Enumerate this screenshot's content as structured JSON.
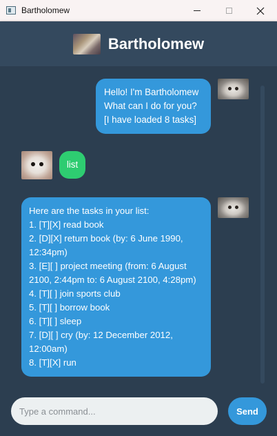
{
  "window": {
    "title": "Bartholomew"
  },
  "header": {
    "title": "Bartholomew"
  },
  "messages": [
    {
      "sender": "bot",
      "text": "Hello! I'm Bartholomew\nWhat can I do for you?\n[I have loaded 8 tasks]"
    },
    {
      "sender": "user",
      "text": "list"
    },
    {
      "sender": "bot",
      "text": "Here are the tasks in your list:\n1. [T][X] read book\n2. [D][X] return book (by: 6 June 1990,\n12:34pm)\n3. [E][ ] project meeting (from: 6 August\n2100, 2:44pm to: 6 August 2100, 4:28pm)\n4. [T][ ] join sports club\n5. [T][ ] borrow book\n6. [T][ ] sleep\n7. [D][ ] cry (by: 12 December 2012,\n12:00am)\n8. [T][X] run"
    }
  ],
  "input": {
    "placeholder": "Type a command...",
    "value": ""
  },
  "send": {
    "label": "Send"
  },
  "colors": {
    "background": "#2c3e50",
    "header": "#34495e",
    "bot_bubble": "#3498db",
    "user_bubble": "#2ecc71",
    "send_button": "#3498db"
  }
}
